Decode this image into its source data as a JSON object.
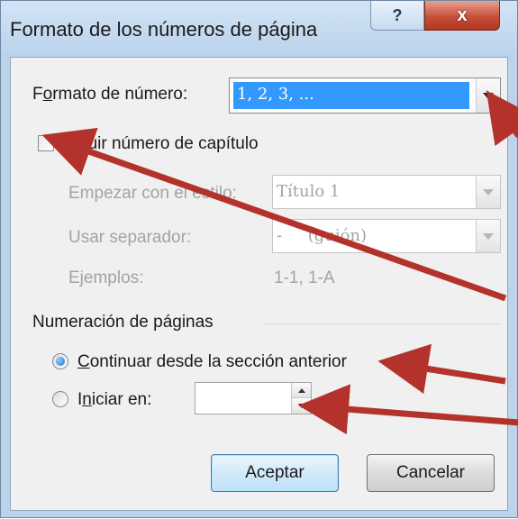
{
  "dialog": {
    "title": "Formato de los números de página",
    "help_label": "?",
    "close_label": "x"
  },
  "number_format": {
    "label_pre": "F",
    "label_mnemonic": "o",
    "label_post": "rmato de número:",
    "value": "1, 2, 3, ..."
  },
  "chapter": {
    "checkbox_label": "Incluir número de capítulo",
    "checked": false,
    "start_style_label": "Empezar con el estilo:",
    "start_style_value": "Título 1",
    "separator_label": "Usar separador:",
    "separator_value": "-     (guión)",
    "examples_label": "Ejemplos:",
    "examples_value": "1-1, 1-A"
  },
  "numbering": {
    "group_label": "Numeración de páginas",
    "continue_mnemonic": "C",
    "continue_rest": "ontinuar desde la sección anterior",
    "continue_selected": true,
    "start_pre": "I",
    "start_mnemonic": "n",
    "start_post": "iciar en:",
    "start_value": ""
  },
  "buttons": {
    "ok_label": "Aceptar",
    "cancel_label": "Cancelar"
  },
  "colors": {
    "annotation_arrow": "#b3322b",
    "selection_highlight": "#3399ff"
  }
}
